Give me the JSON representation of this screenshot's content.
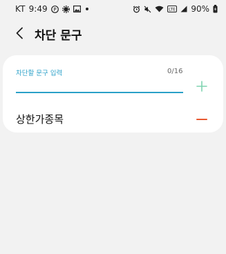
{
  "status_bar": {
    "carrier": "KT",
    "time": "9:49",
    "battery": "90%",
    "left_icons": [
      "p-icon",
      "gear-icon",
      "gallery-icon",
      "dot-icon"
    ],
    "right_icons": [
      "alarm-icon",
      "mute-icon",
      "wifi-icon",
      "volte-icon",
      "signal-icon",
      "battery-icon"
    ]
  },
  "header": {
    "title": "차단 문구",
    "back_icon": "back-arrow-icon"
  },
  "input": {
    "label": "차단할 문구 입력",
    "value": "",
    "counter": "0/16",
    "add_icon": "plus-icon",
    "accent": "#2aa0c8"
  },
  "blocked_phrases": [
    {
      "text": "상한가종목",
      "remove_icon": "minus-icon",
      "remove_color": "#e8572f"
    }
  ]
}
